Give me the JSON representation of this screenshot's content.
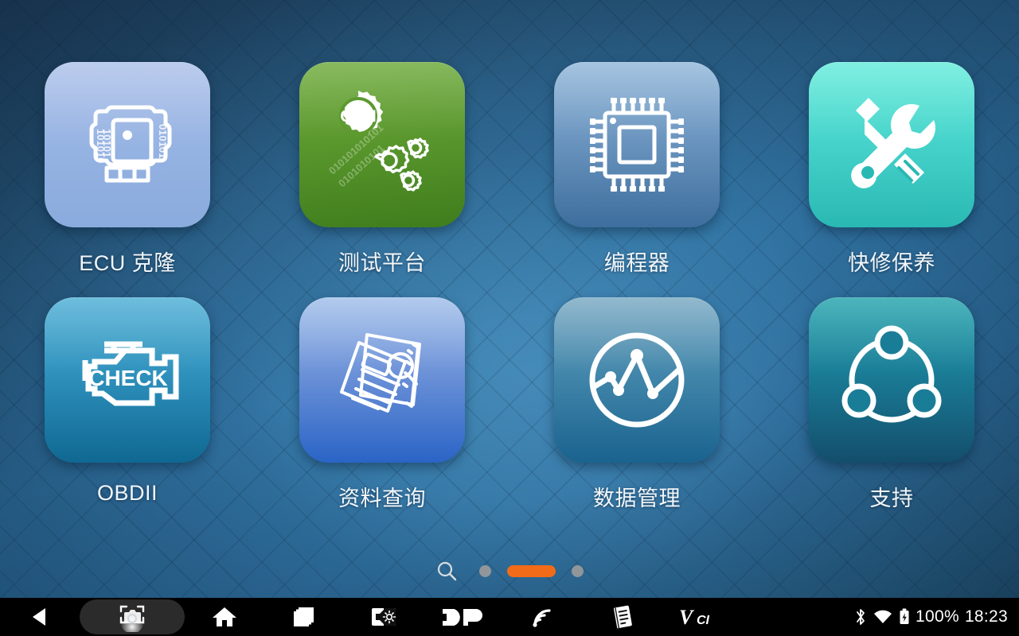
{
  "screen": {
    "background_base": "#2d6d9b",
    "background_dark": "#1d3b58"
  },
  "apps": [
    {
      "id": "ecu-clone",
      "label": "ECU 克隆",
      "icon": "ecu-module-icon",
      "tile_from": "#aabfe8",
      "tile_to": "#8fb0e2"
    },
    {
      "id": "test-platform",
      "label": "测试平台",
      "icon": "can-gears-icon",
      "tile_from": "#6aa839",
      "tile_to": "#3d7a1c"
    },
    {
      "id": "programmer",
      "label": "编程器",
      "icon": "chip-icon",
      "tile_from": "#8fb4d6",
      "tile_to": "#3f6d9c"
    },
    {
      "id": "quick-service",
      "label": "快修保养",
      "icon": "wrench-tools-icon",
      "tile_from": "#61ead9",
      "tile_to": "#2cc0b6"
    },
    {
      "id": "obdii",
      "label": "OBDII",
      "icon": "check-engine-icon",
      "tile_from": "#4aa9d2",
      "tile_to": "#10688f"
    },
    {
      "id": "data-query",
      "label": "资料查询",
      "icon": "documents-search-icon",
      "tile_from": "#9dbbe8",
      "tile_to": "#2a64c4"
    },
    {
      "id": "data-manage",
      "label": "数据管理",
      "icon": "chart-circle-icon",
      "tile_from": "#74a7c2",
      "tile_to": "#1d6694"
    },
    {
      "id": "support",
      "label": "支持",
      "icon": "network-nodes-icon",
      "tile_from": "#23a0ac",
      "tile_to": "#14506e"
    }
  ],
  "page_indicator": {
    "search_icon": "search-icon",
    "dots": [
      "inactive",
      "active",
      "inactive"
    ],
    "active_color": "#f26b18",
    "inactive_color": "#90969a"
  },
  "taskbar": {
    "buttons": [
      {
        "id": "back",
        "icon": "back-triangle-icon",
        "highlighted": false
      },
      {
        "id": "screenshot",
        "icon": "screenshot-camera-icon",
        "highlighted": true
      },
      {
        "id": "home",
        "icon": "home-icon",
        "highlighted": false
      },
      {
        "id": "recents",
        "icon": "recent-apps-icon",
        "highlighted": false
      },
      {
        "id": "volume-brightness",
        "icon": "volume-brightness-icon",
        "highlighted": false
      },
      {
        "id": "dp",
        "icon": "dp-logo-icon",
        "label": "DP",
        "highlighted": false
      },
      {
        "id": "signal",
        "icon": "wifi-signal-icon",
        "highlighted": false
      },
      {
        "id": "notes",
        "icon": "notes-document-icon",
        "highlighted": false
      },
      {
        "id": "vci",
        "icon": "vci-logo-icon",
        "label": "VCI",
        "highlighted": false
      }
    ],
    "status": {
      "bluetooth_icon": "bluetooth-icon",
      "wifi_icon": "wifi-icon",
      "battery_icon": "battery-charging-icon",
      "battery_text": "100%",
      "clock": "18:23"
    }
  }
}
